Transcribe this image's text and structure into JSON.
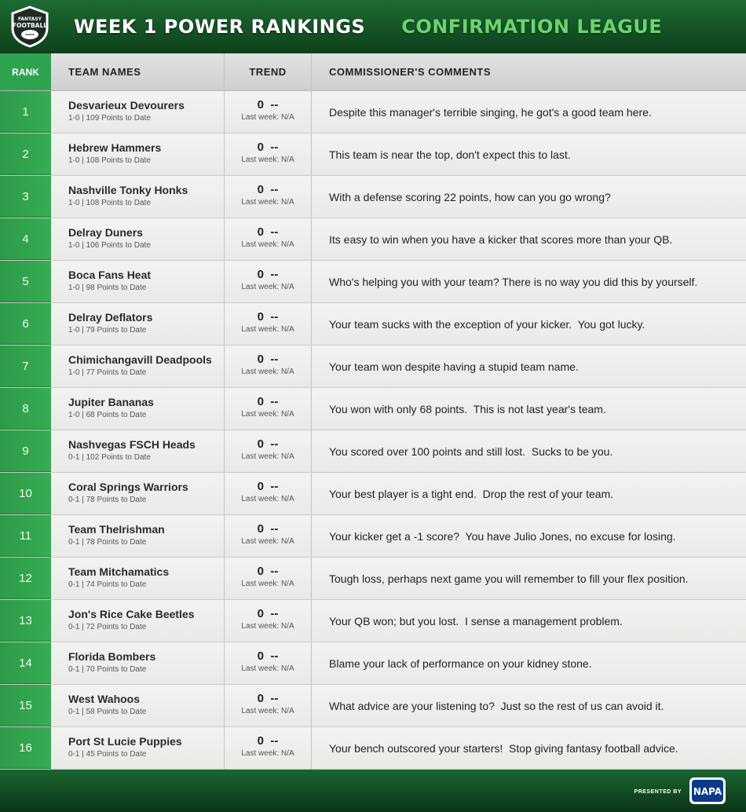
{
  "header": {
    "logo_text_top": "FANTASY",
    "logo_text_main": "FOOTBALL",
    "title": "WEEK 1 POWER RANKINGS",
    "league": "CONFIRMATION LEAGUE"
  },
  "columns": {
    "rank": "RANK",
    "team": "TEAM NAMES",
    "trend": "TREND",
    "comments": "COMMISSIONER'S COMMENTS"
  },
  "rows": [
    {
      "rank": "1",
      "team": "Desvarieux Devourers",
      "record": "1-0 | 109 Points to Date",
      "trend": "0  --",
      "last": "Last week: N/A",
      "comment": "Despite this manager's terrible singing, he got's a good team here."
    },
    {
      "rank": "2",
      "team": "Hebrew Hammers",
      "record": "1-0 | 108 Points to Date",
      "trend": "0  --",
      "last": "Last week: N/A",
      "comment": "This team is near the top, don't expect this to last."
    },
    {
      "rank": "3",
      "team": "Nashville Tonky Honks",
      "record": "1-0 | 108 Points to Date",
      "trend": "0  --",
      "last": "Last week: N/A",
      "comment": "With a defense scoring 22 points, how can you go wrong?"
    },
    {
      "rank": "4",
      "team": "Delray Duners",
      "record": "1-0 | 106 Points to Date",
      "trend": "0  --",
      "last": "Last week: N/A",
      "comment": "Its easy to win when you have a kicker that scores more than your QB."
    },
    {
      "rank": "5",
      "team": "Boca Fans Heat",
      "record": "1-0 | 98 Points to Date",
      "trend": "0  --",
      "last": "Last week: N/A",
      "comment": "Who's helping you with your team? There is no way you did this by yourself."
    },
    {
      "rank": "6",
      "team": "Delray Deflators",
      "record": "1-0 | 79 Points to Date",
      "trend": "0  --",
      "last": "Last week: N/A",
      "comment": "Your team sucks with the exception of your kicker.  You got lucky."
    },
    {
      "rank": "7",
      "team": "Chimichangavill Deadpools",
      "record": "1-0 | 77 Points to Date",
      "trend": "0  --",
      "last": "Last week: N/A",
      "comment": "Your team won despite having a stupid team name."
    },
    {
      "rank": "8",
      "team": "Jupiter Bananas",
      "record": "1-0 | 68 Points to Date",
      "trend": "0  --",
      "last": "Last week: N/A",
      "comment": "You won with only 68 points.  This is not last year's team."
    },
    {
      "rank": "9",
      "team": "Nashvegas FSCH Heads",
      "record": "0-1 | 102 Points to Date",
      "trend": "0  --",
      "last": "Last week: N/A",
      "comment": "You scored over 100 points and still lost.  Sucks to be you."
    },
    {
      "rank": "10",
      "team": "Coral Springs Warriors",
      "record": "0-1 | 78 Points to Date",
      "trend": "0  --",
      "last": "Last week: N/A",
      "comment": "Your best player is a tight end.  Drop the rest of your team."
    },
    {
      "rank": "11",
      "team": "Team TheIrishman",
      "record": "0-1 | 78 Points to Date",
      "trend": "0  --",
      "last": "Last week: N/A",
      "comment": "Your kicker get a -1 score?  You have Julio Jones, no excuse for losing."
    },
    {
      "rank": "12",
      "team": "Team Mitchamatics",
      "record": "0-1 | 74 Points to Date",
      "trend": "0  --",
      "last": "Last week: N/A",
      "comment": "Tough loss, perhaps next game you will remember to fill your flex position."
    },
    {
      "rank": "13",
      "team": "Jon's Rice Cake Beetles",
      "record": "0-1 | 72 Points to Date",
      "trend": "0  --",
      "last": "Last week: N/A",
      "comment": "Your QB won; but you lost.  I sense a management problem."
    },
    {
      "rank": "14",
      "team": "Florida Bombers",
      "record": "0-1 | 70 Points to Date",
      "trend": "0  --",
      "last": "Last week: N/A",
      "comment": "Blame your lack of performance on your kidney stone."
    },
    {
      "rank": "15",
      "team": "West Wahoos",
      "record": "0-1 | 58 Points to Date",
      "trend": "0  --",
      "last": "Last week: N/A",
      "comment": "What advice are your listening to?  Just so the rest of us can avoid it."
    },
    {
      "rank": "16",
      "team": "Port St Lucie Puppies",
      "record": "0-1 | 45 Points to Date",
      "trend": "0  --",
      "last": "Last week: N/A",
      "comment": "Your bench outscored your starters!  Stop giving fantasy football advice."
    }
  ],
  "footer": {
    "presented_by": "PRESENTED BY",
    "sponsor": "NAPA"
  },
  "colors": {
    "brand_green": "#2fa24f",
    "league_green": "#6cd36f",
    "header_dark": "#0e3f1c"
  }
}
